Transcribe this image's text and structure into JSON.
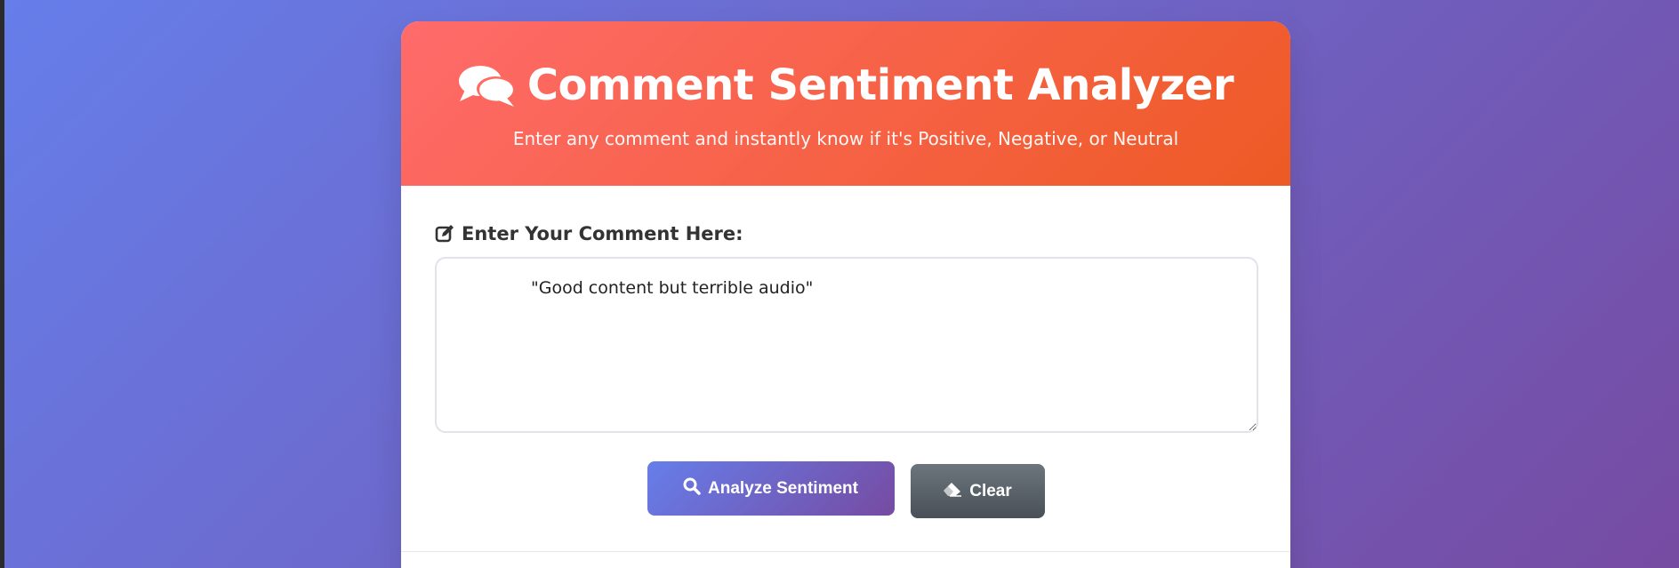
{
  "header": {
    "title": "Comment Sentiment Analyzer",
    "subtitle": "Enter any comment and instantly know if it's Positive, Negative, or Neutral",
    "icon": "comments-icon",
    "gradient_start": "#ff6b6b",
    "gradient_end": "#ee5a24"
  },
  "form": {
    "label": "Enter Your Comment Here:",
    "label_icon": "edit-icon",
    "comment_value": "\"Good content but terrible audio\""
  },
  "buttons": {
    "analyze_label": "Analyze Sentiment",
    "analyze_icon": "search-icon",
    "clear_label": "Clear",
    "clear_icon": "eraser-icon"
  },
  "colors": {
    "background_start": "#667eea",
    "background_end": "#764ba2",
    "clear_button": "#5a6268"
  }
}
